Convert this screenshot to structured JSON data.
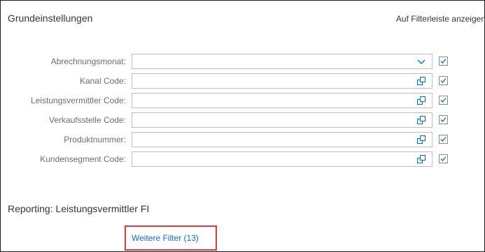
{
  "header": {
    "section_title": "Grundeinstellungen",
    "filterbar_column": "Auf Filterleiste anzeigen"
  },
  "fields": [
    {
      "label": "Abrechnungsmonat:",
      "value": "",
      "icon": "chevron-down-icon",
      "show_on_filterbar": true
    },
    {
      "label": "Kanal Code:",
      "value": "",
      "icon": "value-help-icon",
      "show_on_filterbar": true
    },
    {
      "label": "Leistungsvermittler Code:",
      "value": "",
      "icon": "value-help-icon",
      "show_on_filterbar": true
    },
    {
      "label": "Verkaufsstelle Code:",
      "value": "",
      "icon": "value-help-icon",
      "show_on_filterbar": true
    },
    {
      "label": "Produktnummer:",
      "value": "",
      "icon": "value-help-icon",
      "show_on_filterbar": true
    },
    {
      "label": "Kundensegment Code:",
      "value": "",
      "icon": "value-help-icon",
      "show_on_filterbar": true
    }
  ],
  "group": {
    "title": "Reporting: Leistungsvermittler FI",
    "more_filters_label": "Weitere Filter (13)"
  },
  "colors": {
    "accent": "#0a6ed1",
    "highlight": "#e03b3b",
    "check": "#0a6ed1"
  }
}
